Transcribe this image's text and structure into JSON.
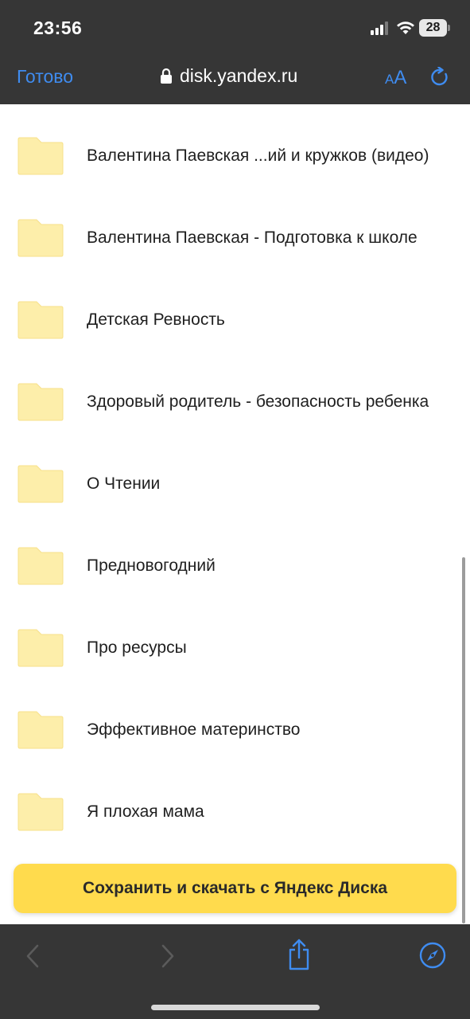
{
  "status_bar": {
    "time": "23:56",
    "battery_level": "28"
  },
  "browser": {
    "done_label": "Готово",
    "url": "disk.yandex.ru",
    "text_size_small": "A",
    "text_size_big": "A"
  },
  "folders": [
    {
      "name": "Валентина Паевская ...ий и кружков (видео)"
    },
    {
      "name": "Валентина Паевская - Подготовка к школе"
    },
    {
      "name": "Детская Ревность"
    },
    {
      "name": "Здоровый родитель - безопасность ребенка"
    },
    {
      "name": "О Чтении"
    },
    {
      "name": "Предновогодний"
    },
    {
      "name": "Про ресурсы"
    },
    {
      "name": "Эффективное материнство"
    },
    {
      "name": "Я плохая мама"
    }
  ],
  "save_button": {
    "label": "Сохранить и скачать с Яндекс Диска",
    "color": "#ffdb4d"
  },
  "colors": {
    "bar_background": "#363636",
    "accent_blue": "#3f8cf0",
    "folder_fill": "#fdeeaa"
  },
  "toolbar": {
    "icons": [
      "back-icon",
      "forward-icon",
      "share-icon",
      "compass-icon"
    ]
  }
}
